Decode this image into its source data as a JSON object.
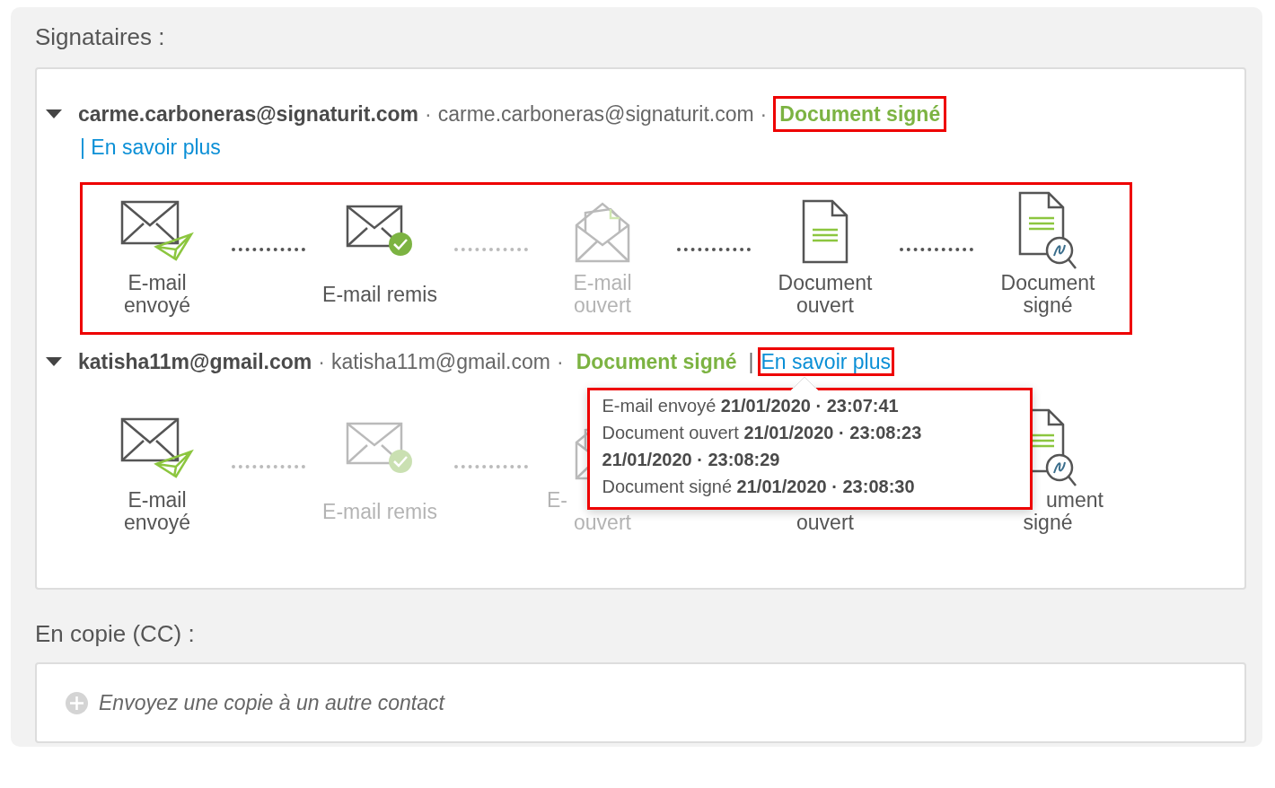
{
  "signers_section": {
    "title": "Signataires :",
    "signers": [
      {
        "expanded": true,
        "name": "carme.carboneras@signaturit.com",
        "separators": [
          "·",
          "·"
        ],
        "email": "carme.carboneras@signaturit.com",
        "status": "Document signé",
        "status_highlighted": true,
        "link": "| En savoir plus",
        "link_highlighted": false,
        "link_wraps": true,
        "steps_highlighted": true,
        "steps": [
          {
            "kind": "mail-sent",
            "done": true,
            "lines": [
              {
                "kind": "whole",
                "text": "E-mail"
              },
              {
                "kind": "whole",
                "text": "envoyé"
              }
            ]
          },
          {
            "kind": "mail-delivered",
            "done": true,
            "lines": [
              {
                "kind": "whole",
                "text": "E-mail remis"
              }
            ]
          },
          {
            "kind": "mail-opened",
            "done": false,
            "lines": [
              {
                "kind": "whole",
                "text": "E-mail"
              },
              {
                "kind": "whole",
                "text": "ouvert"
              }
            ]
          },
          {
            "kind": "doc-opened",
            "done": true,
            "lines": [
              {
                "kind": "whole",
                "text": "Document"
              },
              {
                "kind": "whole",
                "text": "ouvert"
              }
            ]
          },
          {
            "kind": "doc-signed",
            "done": true,
            "lines": [
              {
                "kind": "whole",
                "text": "Document"
              },
              {
                "kind": "whole",
                "text": "signé"
              }
            ]
          }
        ]
      },
      {
        "expanded": true,
        "name": "katisha11m@gmail.com",
        "separators": [
          "·",
          "·",
          "|"
        ],
        "email": "katisha11m@gmail.com",
        "status": "Document signé",
        "status_highlighted": false,
        "link": "En savoir plus",
        "link_highlighted": true,
        "link_wraps": false,
        "steps_highlighted": false,
        "popover": {
          "highlighted": true,
          "entries": [
            "E-mail envoyé **21/01/2020 · 23:07:41**",
            "Document ouvert **21/01/2020 · 23:08:23**",
            "**21/01/2020 · 23:08:29**",
            "Document signé **21/01/2020 · 23:08:30**"
          ]
        },
        "steps": [
          {
            "kind": "mail-sent",
            "done": true,
            "lines": [
              {
                "kind": "whole",
                "text": "E-mail"
              },
              {
                "kind": "whole",
                "text": "envoyé"
              }
            ]
          },
          {
            "kind": "mail-delivered",
            "done": false,
            "lines": [
              {
                "kind": "whole",
                "text": "E-mail remis"
              }
            ]
          },
          {
            "kind": "mail-opened",
            "done": false,
            "lines": [
              {
                "kind": "head",
                "text": "E-"
              },
              {
                "kind": "whole",
                "text": "ouvert"
              }
            ]
          },
          {
            "kind": "doc-opened",
            "done": true,
            "lines": [
              {
                "kind": "lower",
                "text": "ouvert"
              }
            ]
          },
          {
            "kind": "doc-signed",
            "done": true,
            "lines": [
              {
                "kind": "tail",
                "text": "ument"
              },
              {
                "kind": "whole",
                "text": "signé"
              }
            ]
          }
        ]
      }
    ]
  },
  "cc_section": {
    "title": "En copie (CC) :",
    "add_contact": "Envoyez une copie à un autre contact"
  }
}
